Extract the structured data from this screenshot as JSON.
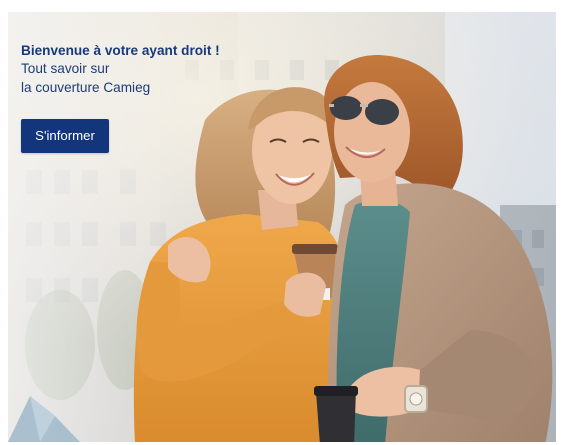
{
  "banner": {
    "title": "Bienvenue à votre ayant droit !",
    "subtitle_line_1": "Tout savoir sur",
    "subtitle_line_2": "la couverture Camieg",
    "cta_label": "S'informer",
    "photo_subject": "two smiling women hugging outdoors, holding coffee cups, city buildings in background",
    "colors": {
      "title": "#173a7a",
      "button": "#12357b",
      "button_text": "#ffffff"
    }
  }
}
